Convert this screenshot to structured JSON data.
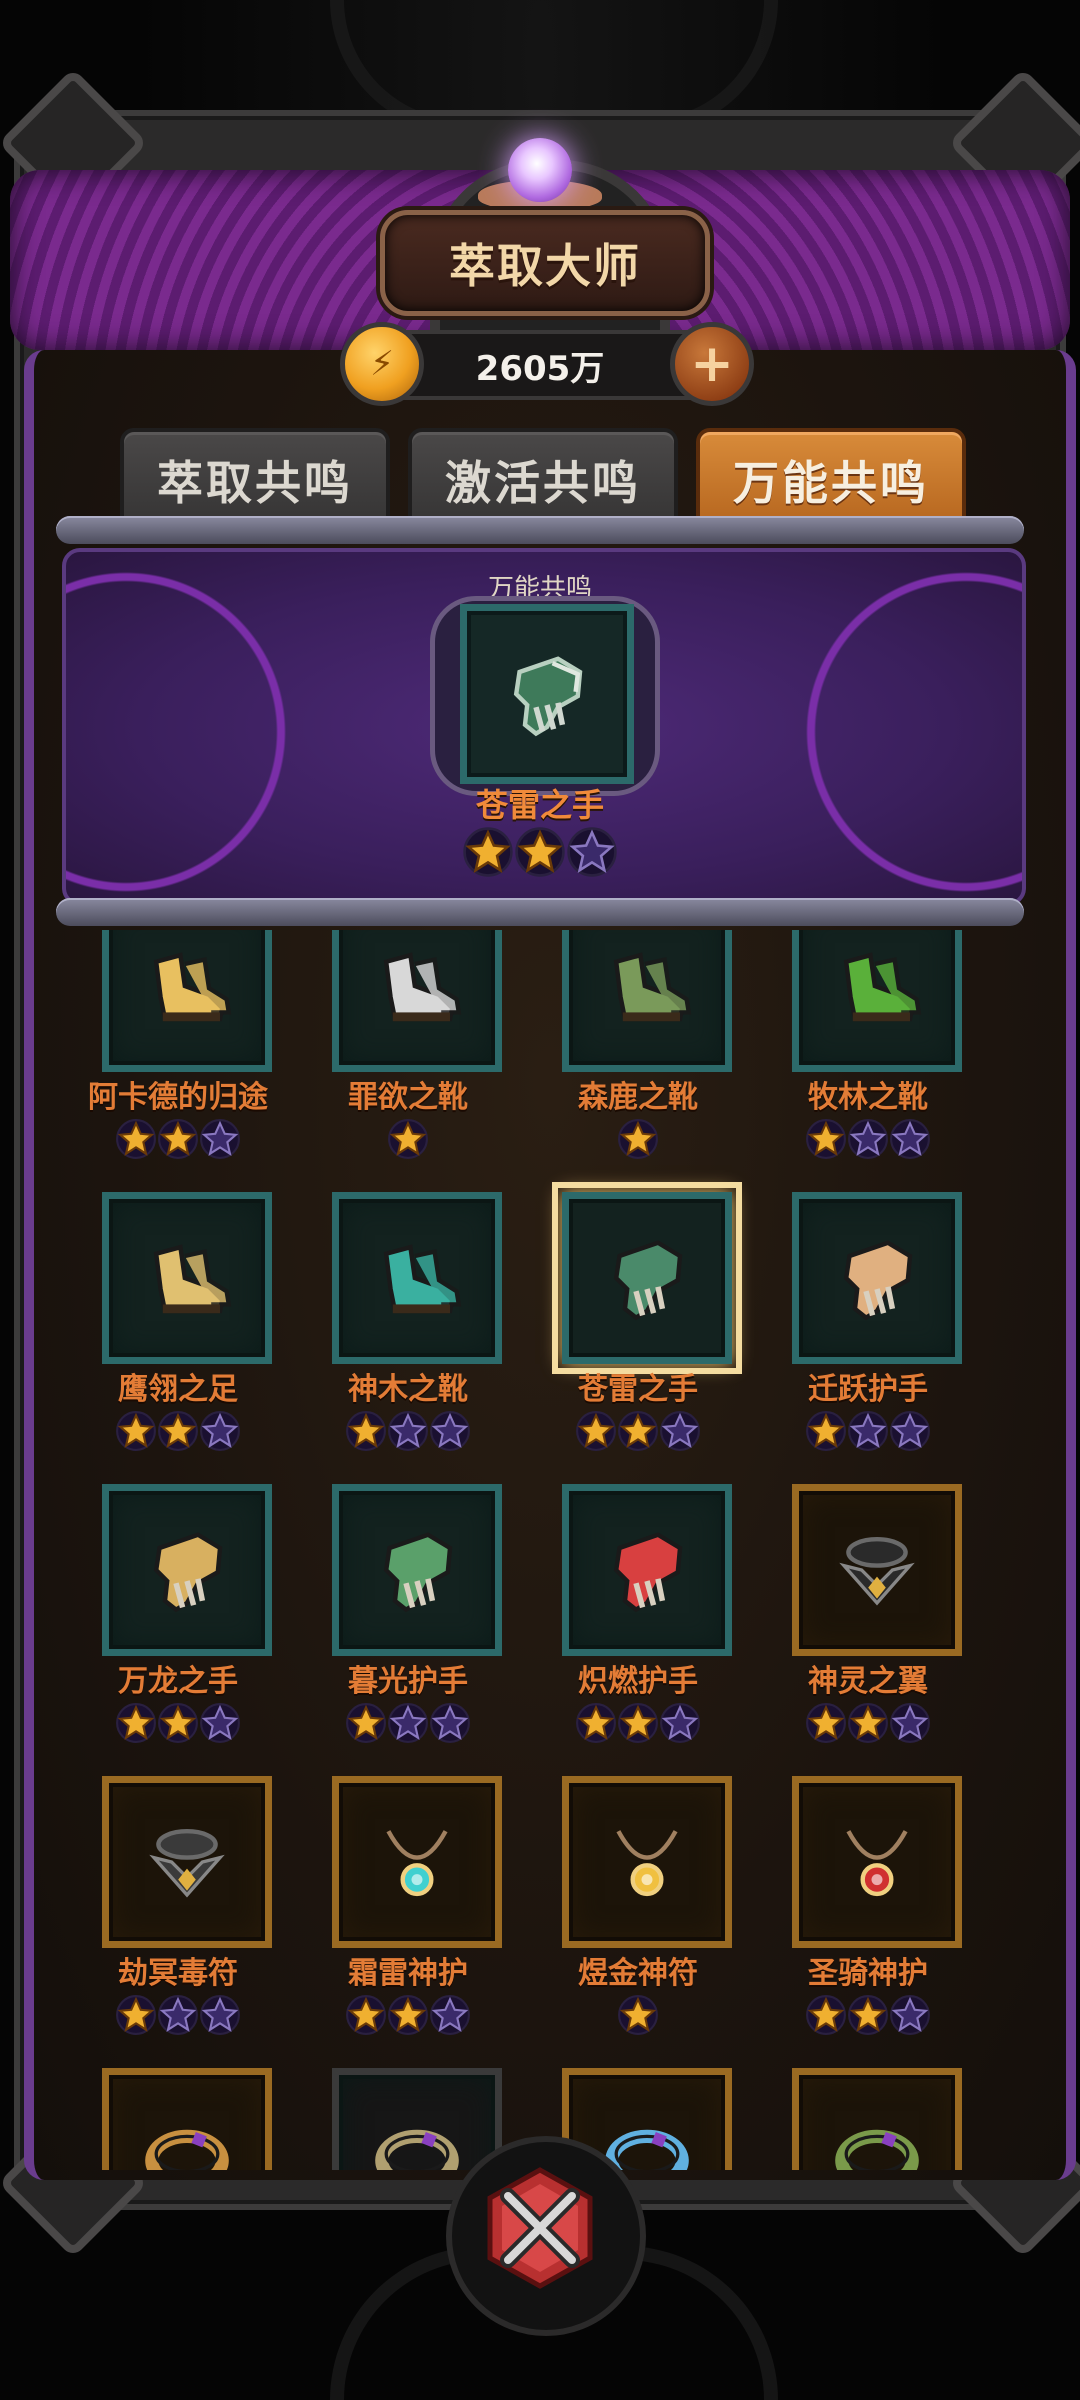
{
  "header": {
    "title": "萃取大师"
  },
  "currency": {
    "icon": "coin-icon",
    "value": "2605万",
    "add_icon": "plus-icon"
  },
  "tabs": [
    {
      "label": "萃取共鸣",
      "active": false
    },
    {
      "label": "激活共鸣",
      "active": false
    },
    {
      "label": "万能共鸣",
      "active": true
    }
  ],
  "featured": {
    "label": "万能共鸣",
    "item": {
      "name": "苍雷之手",
      "icon": "gauntlet-icon",
      "stars": 2,
      "max_stars": 3
    }
  },
  "items": [
    {
      "name": "阿卡德的归途",
      "icon": "boots-icon",
      "color": "#e8c060",
      "frame": "teal",
      "stars": 2,
      "max_stars": 3
    },
    {
      "name": "罪欲之靴",
      "icon": "boots-icon",
      "color": "#d8d8d8",
      "frame": "teal",
      "stars": 1,
      "max_stars": 1
    },
    {
      "name": "森鹿之靴",
      "icon": "boots-icon",
      "color": "#7a9a5a",
      "frame": "teal",
      "stars": 1,
      "max_stars": 1
    },
    {
      "name": "牧林之靴",
      "icon": "boots-icon",
      "color": "#5ab03a",
      "frame": "teal",
      "stars": 1,
      "max_stars": 3
    },
    {
      "name": "鹰翎之足",
      "icon": "boots-icon",
      "color": "#e0c070",
      "frame": "teal",
      "stars": 2,
      "max_stars": 3
    },
    {
      "name": "神木之靴",
      "icon": "boots-icon",
      "color": "#3ab0a0",
      "frame": "teal",
      "stars": 1,
      "max_stars": 3
    },
    {
      "name": "苍雷之手",
      "icon": "gauntlet-icon",
      "color": "#4a8a6a",
      "frame": "teal",
      "selected": true,
      "stars": 2,
      "max_stars": 3
    },
    {
      "name": "迁跃护手",
      "icon": "gauntlet-icon",
      "color": "#e0b080",
      "frame": "teal",
      "stars": 1,
      "max_stars": 3
    },
    {
      "name": "万龙之手",
      "icon": "gauntlet-icon",
      "color": "#d8b060",
      "frame": "teal",
      "stars": 2,
      "max_stars": 3
    },
    {
      "name": "暮光护手",
      "icon": "gauntlet-icon",
      "color": "#5aa06a",
      "frame": "teal",
      "stars": 1,
      "max_stars": 3
    },
    {
      "name": "炽燃护手",
      "icon": "gauntlet-icon",
      "color": "#d84040",
      "frame": "teal",
      "stars": 2,
      "max_stars": 3
    },
    {
      "name": "神灵之翼",
      "icon": "collar-icon",
      "color": "#2a2a2a",
      "frame": "gold",
      "stars": 2,
      "max_stars": 3
    },
    {
      "name": "劫冥毒符",
      "icon": "collar-icon",
      "color": "#3a3a3a",
      "frame": "gold",
      "stars": 1,
      "max_stars": 3
    },
    {
      "name": "霜雷神护",
      "icon": "necklace-icon",
      "color": "#40d0d0",
      "frame": "gold",
      "stars": 2,
      "max_stars": 3
    },
    {
      "name": "煜金神符",
      "icon": "necklace-icon",
      "color": "#f0c040",
      "frame": "gold",
      "stars": 1,
      "max_stars": 1
    },
    {
      "name": "圣骑神护",
      "icon": "necklace-icon",
      "color": "#d03030",
      "frame": "gold",
      "stars": 2,
      "max_stars": 3
    },
    {
      "name": "",
      "icon": "ring-icon",
      "color": "#c89040",
      "frame": "gold",
      "stars": 0,
      "max_stars": 0
    },
    {
      "name": "",
      "icon": "ring-icon",
      "color": "#b0a070",
      "frame": "gray",
      "stars": 0,
      "max_stars": 0
    },
    {
      "name": "",
      "icon": "ring-icon",
      "color": "#60b0e0",
      "frame": "gold",
      "stars": 0,
      "max_stars": 0
    },
    {
      "name": "",
      "icon": "ring-icon",
      "color": "#7a9a4a",
      "frame": "gold",
      "stars": 0,
      "max_stars": 0
    }
  ],
  "close_button": {
    "icon": "close-x-icon"
  }
}
